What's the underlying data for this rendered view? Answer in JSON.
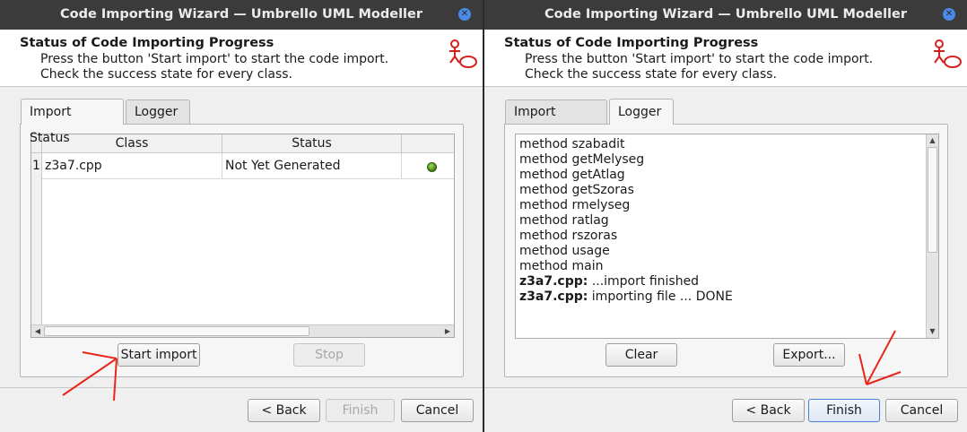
{
  "left": {
    "window_title": "Code Importing Wizard — Umbrello UML Modeller",
    "header": {
      "title": "Status of Code Importing Progress",
      "line1": "Press the button 'Start import' to start the code import.",
      "line2": "Check the success state for every class."
    },
    "tabs": [
      "Import Status",
      "Logger"
    ],
    "active_tab": "Import Status",
    "table": {
      "columns": [
        "Class",
        "Status"
      ],
      "rows": [
        {
          "num": "1",
          "class": "z3a7.cpp",
          "status": "Not Yet Generated"
        }
      ]
    },
    "buttons": {
      "start_import": "Start import",
      "stop": "Stop",
      "back": "< Back",
      "finish": "Finish",
      "cancel": "Cancel"
    }
  },
  "right": {
    "window_title": "Code Importing Wizard — Umbrello UML Modeller",
    "header": {
      "title": "Status of Code Importing Progress",
      "line1": "Press the button 'Start import' to start the code import.",
      "line2": "Check the success state for every class."
    },
    "tabs": [
      "Import Status",
      "Logger"
    ],
    "active_tab": "Logger",
    "log": [
      {
        "bold": "",
        "text": "method szabadit"
      },
      {
        "bold": "",
        "text": "method getMelyseg"
      },
      {
        "bold": "",
        "text": "method getAtlag"
      },
      {
        "bold": "",
        "text": "method getSzoras"
      },
      {
        "bold": "",
        "text": "method rmelyseg"
      },
      {
        "bold": "",
        "text": "method ratlag"
      },
      {
        "bold": "",
        "text": "method rszoras"
      },
      {
        "bold": "",
        "text": "method usage"
      },
      {
        "bold": "",
        "text": "method main"
      },
      {
        "bold": "z3a7.cpp:",
        "text": " ...import finished"
      },
      {
        "bold": "z3a7.cpp:",
        "text": " importing file ... DONE"
      }
    ],
    "buttons": {
      "clear": "Clear",
      "export": "Export...",
      "back": "< Back",
      "finish": "Finish",
      "cancel": "Cancel"
    }
  },
  "colors": {
    "annotation_arrow": "#e8261c",
    "titlebar": "#3b3b3b",
    "close_button": "#4a8ae8",
    "status_led": "#5aa51e"
  }
}
